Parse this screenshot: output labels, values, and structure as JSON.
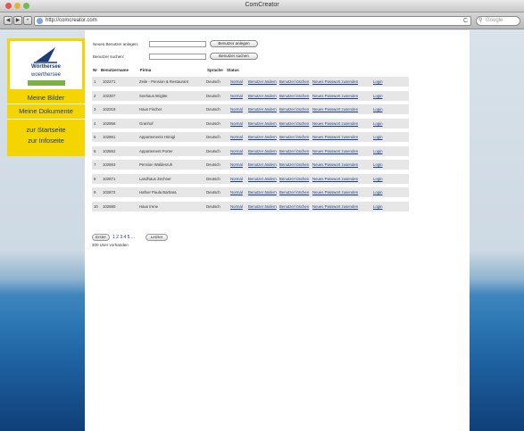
{
  "window": {
    "title": "ComCreator"
  },
  "toolbar": {
    "back": "◀",
    "forward": "▶",
    "add": "+",
    "url": "http://comcreator.com",
    "reload": "C",
    "search_placeholder": "Google"
  },
  "logo": {
    "name": "Wörthersee",
    "tagline": "woerthersee"
  },
  "sidebar": {
    "items": [
      "Meine Bilder",
      "Meine Dokumente",
      "zur Startseite",
      "zur Infoseite"
    ]
  },
  "form": {
    "new_label": "Neuen Benutzer anlegen:",
    "new_button": "Benutzer anlegen",
    "search_label": "Benutzer suchen:",
    "search_button": "Benutzer suchen"
  },
  "table": {
    "headers": [
      "Nr",
      "Benutzername",
      "Firma",
      "Sprache",
      "Status"
    ],
    "link_labels": [
      "Normal",
      "Benutzer ändern",
      "Benutzer löschen",
      "Neues Passwort zusenden",
      "Login"
    ],
    "rows": [
      {
        "nr": "1",
        "user": "102271",
        "firma": "Zeile - Pension & Restaurant",
        "lang": "Deutsch"
      },
      {
        "nr": "2",
        "user": "102307",
        "firma": "Seehaus Brigitte",
        "lang": "Deutsch"
      },
      {
        "nr": "3",
        "user": "102319",
        "firma": "Haus Fischer",
        "lang": "Deutsch"
      },
      {
        "nr": "4",
        "user": "102856",
        "firma": "Granhof",
        "lang": "Deutsch"
      },
      {
        "nr": "5",
        "user": "102861",
        "firma": "Appartements Hönigl",
        "lang": "Deutsch"
      },
      {
        "nr": "6",
        "user": "102862",
        "firma": "Appartement Porter",
        "lang": "Deutsch"
      },
      {
        "nr": "7",
        "user": "102863",
        "firma": "Pension Waldesruh",
        "lang": "Deutsch"
      },
      {
        "nr": "8",
        "user": "102871",
        "firma": "Landhaus Zechner",
        "lang": "Deutsch"
      },
      {
        "nr": "9",
        "user": "102872",
        "firma": "Hafner Paula Barbara",
        "lang": "Deutsch"
      },
      {
        "nr": "10",
        "user": "102880",
        "firma": "Haus Irene",
        "lang": "Deutsch"
      }
    ]
  },
  "pager": {
    "prev": "Erster",
    "pages": "1 2 3 4 5 ...",
    "next": "Letzter",
    "count": "300 User vorhanden"
  }
}
